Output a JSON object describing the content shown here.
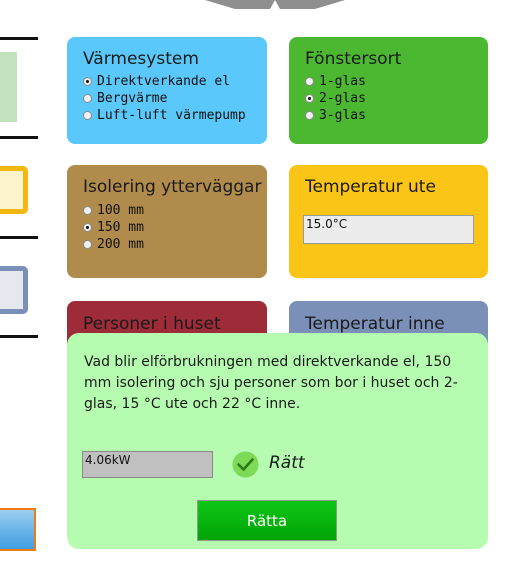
{
  "heating": {
    "title": "Värmesystem",
    "options": [
      "Direktverkande el",
      "Bergvärme",
      "Luft-luft värmepump"
    ],
    "selected_index": 0
  },
  "window": {
    "title": "Fönstersort",
    "options": [
      "1-glas",
      "2-glas",
      "3-glas"
    ],
    "selected_index": 1
  },
  "insulation": {
    "title": "Isolering ytterväggar",
    "options": [
      "100 mm",
      "150 mm",
      "200 mm"
    ],
    "selected_index": 1
  },
  "outdoor_temp": {
    "title": "Temperatur ute",
    "value": "15.0°C"
  },
  "persons": {
    "title": "Personer i huset"
  },
  "indoor_temp": {
    "title": "Temperatur inne"
  },
  "quiz": {
    "question": "Vad blir elförbrukningen med direktverkande el, 150 mm isolering och sju personer som bor i huset och 2-glas, 15 °C ute och 22 °C inne.",
    "answer": "4.06kW",
    "feedback": "Rätt",
    "check_button": "Rätta"
  },
  "colors": {
    "heating": "#5ac8fa",
    "window": "#4cb832",
    "insulation": "#b08b4b",
    "outdoor": "#fac516",
    "persons": "#9e2c38",
    "indoor": "#7a90b8",
    "quiz_panel": "#b6fcb0",
    "check_button": "#07b10c"
  },
  "icons": {
    "correct": "check-circle-icon"
  }
}
